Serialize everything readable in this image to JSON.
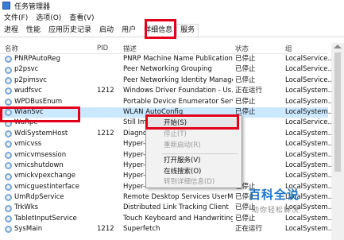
{
  "window": {
    "title": "任务管理器"
  },
  "menu": [
    "文件(F)",
    "选项(O)",
    "查看(V)"
  ],
  "tabs": [
    "进程",
    "性能",
    "应用历史记录",
    "启动",
    "用户",
    "详细信息",
    "服务"
  ],
  "active_tab": "服务",
  "columns": {
    "name": "名称",
    "pid": "PID",
    "desc": "描述",
    "status": "状态",
    "group": "组"
  },
  "rows": [
    {
      "name": "PNRPAutoReg",
      "pid": "",
      "desc": "PNRP Machine Name Publication...",
      "status": "已停止",
      "group": "LocalService..."
    },
    {
      "name": "p2psvc",
      "pid": "",
      "desc": "Peer Networking Grouping",
      "status": "已停止",
      "group": "LocalService..."
    },
    {
      "name": "p2pimsvc",
      "pid": "",
      "desc": "Peer Networking Identity Manager",
      "status": "已停止",
      "group": "LocalService..."
    },
    {
      "name": "wudfsvc",
      "pid": "1212",
      "desc": "Windows Driver Foundation - Us...",
      "status": "正在运行",
      "group": "LocalSystem..."
    },
    {
      "name": "WPDBusEnum",
      "pid": "",
      "desc": "Portable Device Enumerator Serv...",
      "status": "已停止",
      "group": "LocalSystem..."
    },
    {
      "name": "WlanSvc",
      "pid": "",
      "desc": "WLAN AutoConfig",
      "status": "已停止",
      "group": "LocalSystem...",
      "selected": true
    },
    {
      "name": "WaRpc",
      "pid": "",
      "desc": "Still Im...",
      "status": "",
      "group": "LocalService..."
    },
    {
      "name": "WdiSystemHost",
      "pid": "1212",
      "desc": "Diagnos...",
      "status": "",
      "group": "LocalSystem..."
    },
    {
      "name": "vmicvss",
      "pid": "",
      "desc": "Hyper-V...",
      "status": "",
      "group": "LocalSystem..."
    },
    {
      "name": "vmicvmsession",
      "pid": "",
      "desc": "Hyper-V...",
      "status": "",
      "group": "LocalSystem..."
    },
    {
      "name": "vmicshutdown",
      "pid": "",
      "desc": "Hyper-V...",
      "status": "",
      "group": "LocalSystem..."
    },
    {
      "name": "vmickvpexchange",
      "pid": "",
      "desc": "Hyper-V...",
      "status": "",
      "group": "LocalSystem..."
    },
    {
      "name": "vmicguestinterface",
      "pid": "",
      "desc": "Hyper-V Guest Service Interface",
      "status": "已停止",
      "group": "LocalSystem..."
    },
    {
      "name": "UmRdpService",
      "pid": "",
      "desc": "Remote Desktop Services UserM...",
      "status": "已停止",
      "group": "LocalSystem..."
    },
    {
      "name": "TrkWks",
      "pid": "",
      "desc": "Distributed Link Tracking Client",
      "status": "已停止",
      "group": "LocalSystem..."
    },
    {
      "name": "TabletInputService",
      "pid": "",
      "desc": "Touch Keyboard and Handwriting...",
      "status": "已停止",
      "group": "LocalSystem..."
    },
    {
      "name": "SysMain",
      "pid": "1212",
      "desc": "Superfetch",
      "status": "正在运行",
      "group": "LocalSystem..."
    }
  ],
  "context_menu": [
    {
      "label": "开始(S)",
      "disabled": false
    },
    {
      "label": "停止(T)",
      "disabled": true
    },
    {
      "label": "重新启动(R)",
      "disabled": true
    },
    {
      "label": "打开服务(V)",
      "disabled": false
    },
    {
      "label": "在线搜索(O)",
      "disabled": false
    },
    {
      "label": "转到详细信息(D)",
      "disabled": true
    }
  ],
  "watermark": {
    "logo": "百科全说",
    "subtitle": "助你轻松解决"
  },
  "colors": {
    "highlight_border": "#e2001a",
    "selected_row": "#cce8ff"
  }
}
